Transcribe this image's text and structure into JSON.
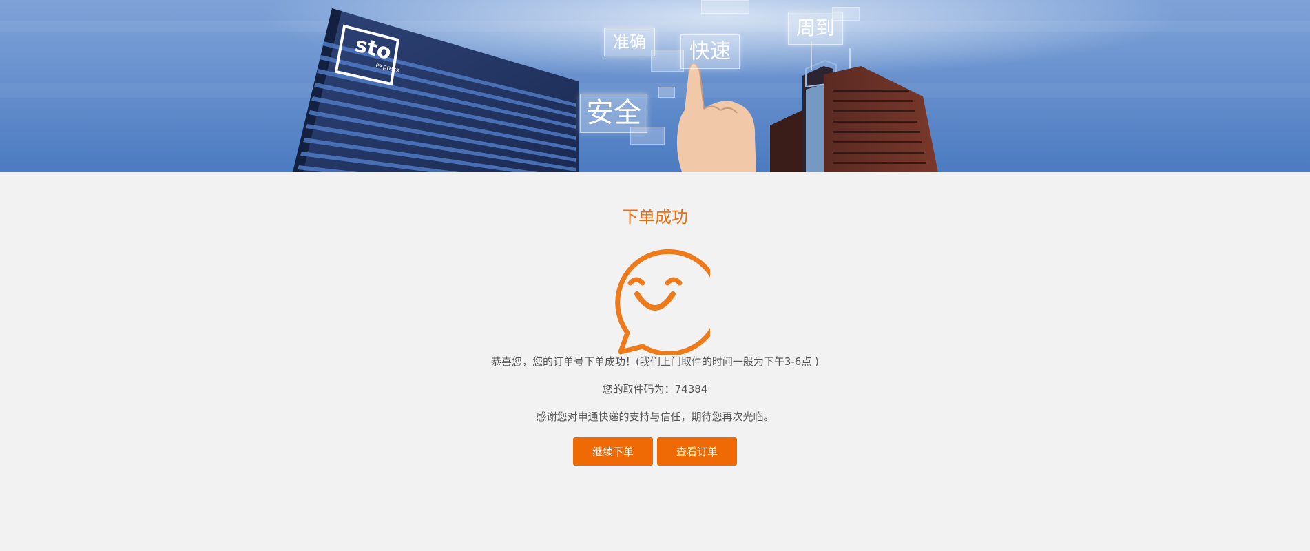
{
  "banner": {
    "logo_text": "sto",
    "logo_sub": "express",
    "tags": {
      "accurate": "准确",
      "fast": "快速",
      "considerate": "周到",
      "safe": "安全"
    }
  },
  "main": {
    "title": "下单成功",
    "message_line1": "恭喜您，您的订单号下单成功！(我们上门取件的时间一般为下午3-6点 )",
    "pickup_code_line": "您的取件码为：74384",
    "thanks_line": "感谢您对申通快递的支持与信任，期待您再次光临。",
    "continue_button": "继续下单",
    "view_orders_button": "查看订单"
  },
  "colors": {
    "accent": "#ef6c0f",
    "button": "#ef6a05",
    "background": "#f2f2f2",
    "banner_sky": "#5a85c8"
  },
  "icons": {
    "success": "smiley-speech-bubble-icon"
  }
}
